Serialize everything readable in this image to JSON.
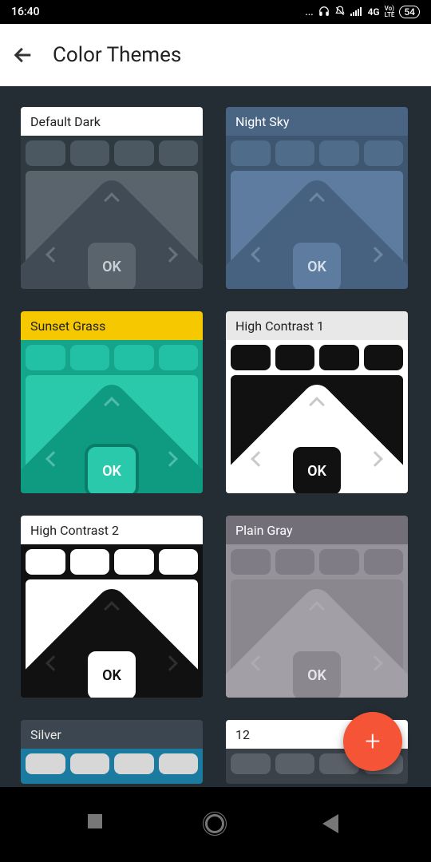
{
  "status": {
    "time": "16:40",
    "dots": "...",
    "network": "4G",
    "volte": "Vo)\nLTE",
    "battery": "54"
  },
  "appbar": {
    "title": "Color Themes"
  },
  "ok_label": "OK",
  "themes": [
    {
      "name": "Default Dark",
      "header_bg": "#ffffff",
      "header_fg": "#222222",
      "preview_bg": "#2e3940",
      "pill_bg": "#4b5761",
      "dpad_bg": "#5a646d",
      "diamond_bg": "#414b55",
      "ok_bg": "#5a646d",
      "ok_border": "#414b55",
      "ok_fg": "#c8d0d6",
      "chev": "#98a2ab"
    },
    {
      "name": "Night Sky",
      "header_bg": "#4a6583",
      "header_fg": "#ffffff",
      "preview_bg": "#3f5671",
      "pill_bg": "#506c8b",
      "dpad_bg": "#5d7ca0",
      "diamond_bg": "#476280",
      "ok_bg": "#5d7ca0",
      "ok_border": "#476280",
      "ok_fg": "#d6e0ea",
      "chev": "#9db2c8"
    },
    {
      "name": "Sunset Grass",
      "header_bg": "#f5c800",
      "header_fg": "#222222",
      "preview_bg": "#14a58b",
      "pill_bg": "#22c0a4",
      "dpad_bg": "#2bc9ac",
      "diamond_bg": "#0f9b82",
      "ok_bg": "#2bc9ac",
      "ok_border": "#0a7d68",
      "ok_fg": "#ffffff",
      "chev": "#9de8d9"
    },
    {
      "name": "High Contrast 1",
      "header_bg": "#e8e8e8",
      "header_fg": "#222222",
      "preview_bg": "#ffffff",
      "pill_bg": "#111111",
      "dpad_bg": "#111111",
      "diamond_bg": "#ffffff",
      "ok_bg": "#111111",
      "ok_border": "#ffffff",
      "ok_fg": "#ffffff",
      "chev": "#888888"
    },
    {
      "name": "High Contrast 2",
      "header_bg": "#ffffff",
      "header_fg": "#222222",
      "preview_bg": "#111111",
      "pill_bg": "#ffffff",
      "dpad_bg": "#ffffff",
      "diamond_bg": "#111111",
      "ok_bg": "#ffffff",
      "ok_border": "#111111",
      "ok_fg": "#111111",
      "chev": "#555555"
    },
    {
      "name": "Plain Gray",
      "header_bg": "#726f78",
      "header_fg": "#ffffff",
      "preview_bg": "#969299",
      "pill_bg": "#807c85",
      "dpad_bg": "#8b878e",
      "diamond_bg": "#a39fa7",
      "ok_bg": "#8b878e",
      "ok_border": "#a39fa7",
      "ok_fg": "#e6e4e8",
      "chev": "#bcb9bf"
    },
    {
      "name": "Silver",
      "header_bg": "#3c4650",
      "header_fg": "#e8e8e8",
      "preview_bg": "#1a7aa0",
      "pill_bg": "#d7d7d7",
      "short": true
    },
    {
      "name": "12",
      "header_bg": "#ffffff",
      "header_fg": "#222222",
      "preview_bg": "#3a4148",
      "pill_bg": "#5a6068",
      "short": true
    }
  ]
}
